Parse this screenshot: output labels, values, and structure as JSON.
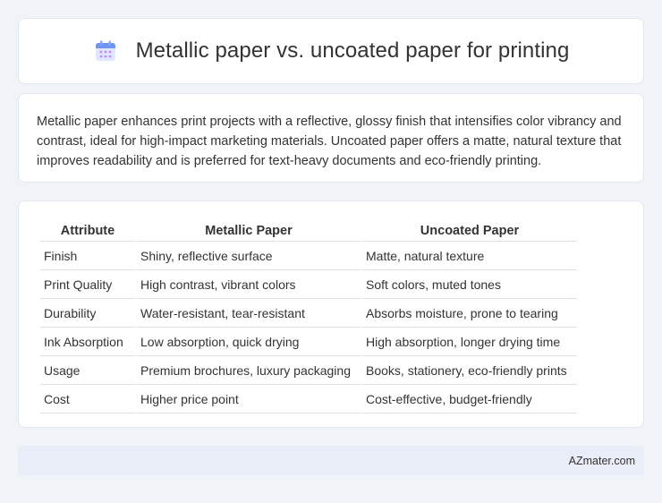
{
  "header": {
    "title": "Metallic paper vs. uncoated paper for printing",
    "icon": "calendar-icon"
  },
  "summary": {
    "text": "Metallic paper enhances print projects with a reflective, glossy finish that intensifies color vibrancy and contrast, ideal for high-impact marketing materials. Uncoated paper offers a matte, natural texture that improves readability and is preferred for text-heavy documents and eco-friendly printing."
  },
  "table": {
    "headers": [
      "Attribute",
      "Metallic Paper",
      "Uncoated Paper"
    ],
    "rows": [
      [
        "Finish",
        "Shiny, reflective surface",
        "Matte, natural texture"
      ],
      [
        "Print Quality",
        "High contrast, vibrant colors",
        "Soft colors, muted tones"
      ],
      [
        "Durability",
        "Water-resistant, tear-resistant",
        "Absorbs moisture, prone to tearing"
      ],
      [
        "Ink Absorption",
        "Low absorption, quick drying",
        "High absorption, longer drying time"
      ],
      [
        "Usage",
        "Premium brochures, luxury packaging",
        "Books, stationery, eco-friendly prints"
      ],
      [
        "Cost",
        "Higher price point",
        "Cost-effective, budget-friendly"
      ]
    ]
  },
  "footer": {
    "brand": "AZmater.com"
  },
  "colors": {
    "background": "#f0f3f8",
    "card": "#ffffff",
    "footer": "#e8edf7",
    "icon_accent": "#5b8def"
  }
}
